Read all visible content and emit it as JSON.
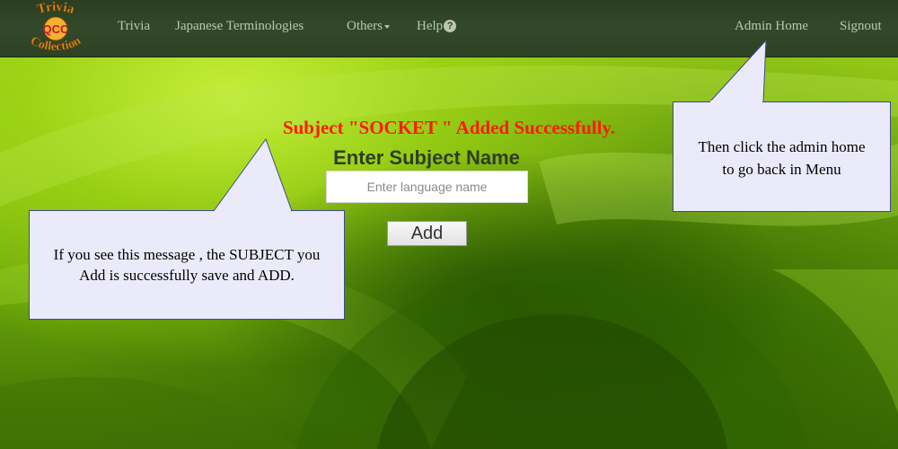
{
  "navbar": {
    "logo": {
      "top_text": "Trivia",
      "center_text": "QCC",
      "bottom_text": "Collection"
    },
    "items": [
      {
        "label": "Trivia"
      },
      {
        "label": "Japanese Terminologies"
      },
      {
        "label": "Others"
      },
      {
        "label": "Help"
      }
    ],
    "right_items": [
      {
        "label": "Admin Home"
      },
      {
        "label": "Signout"
      }
    ]
  },
  "main": {
    "success_message": "Subject \"SOCKET \" Added Successfully.",
    "form_title": "Enter Subject Name",
    "input_placeholder": "Enter language name",
    "input_value": "",
    "add_button_label": "Add"
  },
  "callouts": {
    "left_line1": "If you see this message , the SUBJECT you",
    "left_line2": "Add is successfully save and ADD.",
    "right_line1": "Then click the admin home",
    "right_line2": "to go back in Menu"
  },
  "colors": {
    "navbar_bg": "#33492a",
    "nav_text": "#b9c7b0",
    "success_text": "#ff1a00",
    "callout_fill": "#ebeafa",
    "callout_border": "#3d4a8c"
  }
}
